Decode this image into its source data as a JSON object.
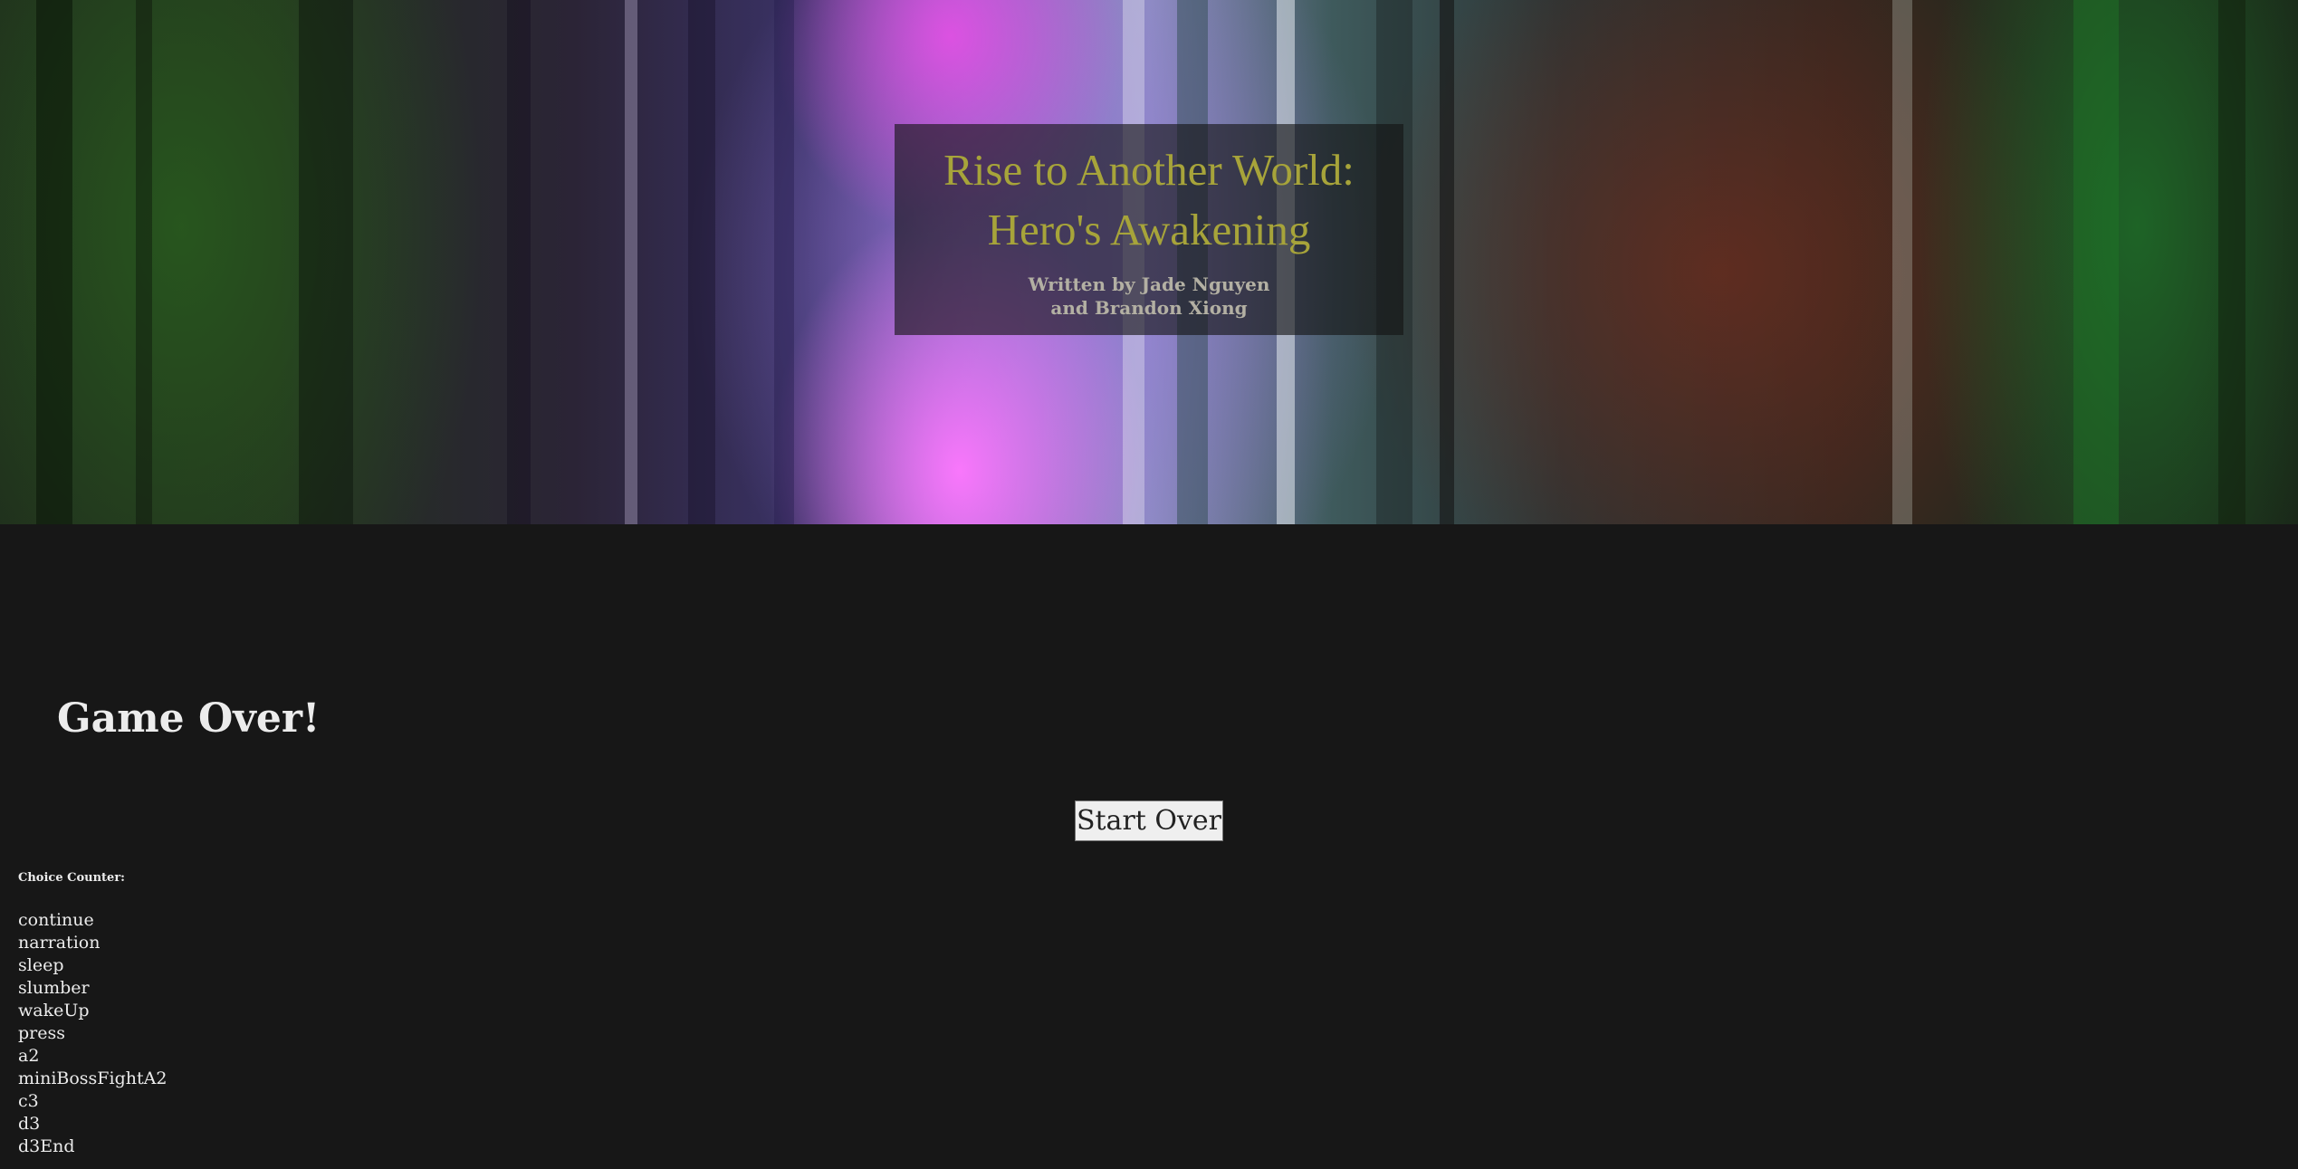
{
  "header": {
    "title_line1": "Rise to Another World:",
    "title_line2": "Hero's Awakening",
    "byline_line1": "Written by Jade Nguyen",
    "byline_line2": "and Brandon Xiong"
  },
  "game": {
    "status_text": "Game Over!",
    "start_over_label": "Start Over"
  },
  "choice_counter": {
    "label": "Choice Counter:",
    "items": [
      "continue",
      "narration",
      "sleep",
      "slumber",
      "wakeUp",
      "press",
      "a2",
      "miniBossFightA2",
      "c3",
      "d3",
      "d3End"
    ]
  },
  "colors": {
    "page_background": "#171717",
    "title_gold": "#a7a43a",
    "text_light": "#ececec"
  }
}
